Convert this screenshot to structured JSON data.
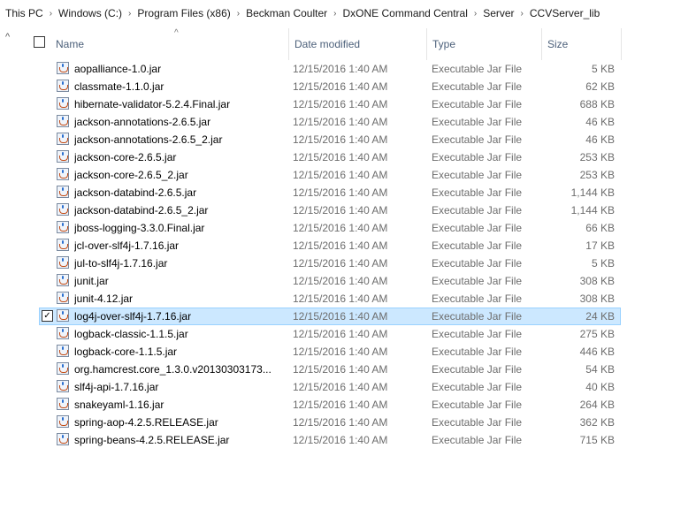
{
  "breadcrumb": [
    "This PC",
    "Windows (C:)",
    "Program Files (x86)",
    "Beckman Coulter",
    "DxONE Command Central",
    "Server",
    "CCVServer_lib"
  ],
  "columns": {
    "name": "Name",
    "date": "Date modified",
    "type": "Type",
    "size": "Size"
  },
  "files": [
    {
      "name": "aopalliance-1.0.jar",
      "date": "12/15/2016 1:40 AM",
      "type": "Executable Jar File",
      "size": "5 KB"
    },
    {
      "name": "classmate-1.1.0.jar",
      "date": "12/15/2016 1:40 AM",
      "type": "Executable Jar File",
      "size": "62 KB"
    },
    {
      "name": "hibernate-validator-5.2.4.Final.jar",
      "date": "12/15/2016 1:40 AM",
      "type": "Executable Jar File",
      "size": "688 KB"
    },
    {
      "name": "jackson-annotations-2.6.5.jar",
      "date": "12/15/2016 1:40 AM",
      "type": "Executable Jar File",
      "size": "46 KB"
    },
    {
      "name": "jackson-annotations-2.6.5_2.jar",
      "date": "12/15/2016 1:40 AM",
      "type": "Executable Jar File",
      "size": "46 KB"
    },
    {
      "name": "jackson-core-2.6.5.jar",
      "date": "12/15/2016 1:40 AM",
      "type": "Executable Jar File",
      "size": "253 KB"
    },
    {
      "name": "jackson-core-2.6.5_2.jar",
      "date": "12/15/2016 1:40 AM",
      "type": "Executable Jar File",
      "size": "253 KB"
    },
    {
      "name": "jackson-databind-2.6.5.jar",
      "date": "12/15/2016 1:40 AM",
      "type": "Executable Jar File",
      "size": "1,144 KB"
    },
    {
      "name": "jackson-databind-2.6.5_2.jar",
      "date": "12/15/2016 1:40 AM",
      "type": "Executable Jar File",
      "size": "1,144 KB"
    },
    {
      "name": "jboss-logging-3.3.0.Final.jar",
      "date": "12/15/2016 1:40 AM",
      "type": "Executable Jar File",
      "size": "66 KB"
    },
    {
      "name": "jcl-over-slf4j-1.7.16.jar",
      "date": "12/15/2016 1:40 AM",
      "type": "Executable Jar File",
      "size": "17 KB"
    },
    {
      "name": "jul-to-slf4j-1.7.16.jar",
      "date": "12/15/2016 1:40 AM",
      "type": "Executable Jar File",
      "size": "5 KB"
    },
    {
      "name": "junit.jar",
      "date": "12/15/2016 1:40 AM",
      "type": "Executable Jar File",
      "size": "308 KB"
    },
    {
      "name": "junit-4.12.jar",
      "date": "12/15/2016 1:40 AM",
      "type": "Executable Jar File",
      "size": "308 KB"
    },
    {
      "name": "log4j-over-slf4j-1.7.16.jar",
      "date": "12/15/2016 1:40 AM",
      "type": "Executable Jar File",
      "size": "24 KB",
      "selected": true
    },
    {
      "name": "logback-classic-1.1.5.jar",
      "date": "12/15/2016 1:40 AM",
      "type": "Executable Jar File",
      "size": "275 KB"
    },
    {
      "name": "logback-core-1.1.5.jar",
      "date": "12/15/2016 1:40 AM",
      "type": "Executable Jar File",
      "size": "446 KB"
    },
    {
      "name": "org.hamcrest.core_1.3.0.v20130303173...",
      "date": "12/15/2016 1:40 AM",
      "type": "Executable Jar File",
      "size": "54 KB"
    },
    {
      "name": "slf4j-api-1.7.16.jar",
      "date": "12/15/2016 1:40 AM",
      "type": "Executable Jar File",
      "size": "40 KB"
    },
    {
      "name": "snakeyaml-1.16.jar",
      "date": "12/15/2016 1:40 AM",
      "type": "Executable Jar File",
      "size": "264 KB"
    },
    {
      "name": "spring-aop-4.2.5.RELEASE.jar",
      "date": "12/15/2016 1:40 AM",
      "type": "Executable Jar File",
      "size": "362 KB"
    },
    {
      "name": "spring-beans-4.2.5.RELEASE.jar",
      "date": "12/15/2016 1:40 AM",
      "type": "Executable Jar File",
      "size": "715 KB"
    }
  ]
}
